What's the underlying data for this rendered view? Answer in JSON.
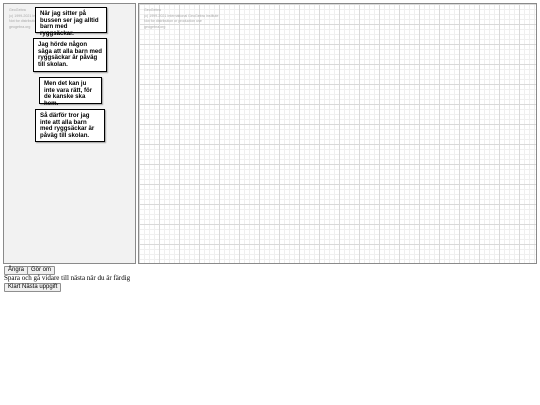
{
  "watermark": {
    "line1": "GeoGebra",
    "line2": "(c) 1999-2021 International GeoGebra Institute",
    "line3": "Not for distribution or production use",
    "line4": "geogebra.org"
  },
  "notes": [
    {
      "text": "När jag sitter på bussen ser jag alltid barn med ryggsäckar."
    },
    {
      "text": "Jag hörde någon säga att alla barn med ryggsäckar är påväg till skolan."
    },
    {
      "text": "Men det kan ju inte vara rätt, för de kanske ska hem."
    },
    {
      "text": "Så därför tror jag inte att alla barn med ryggsäckar är påväg till skolan."
    }
  ],
  "controls": {
    "undo_label": "Ångra",
    "redo_label": "Gör om",
    "instruction": "Spara och gå vidare till nästa när du är färdig",
    "next_label": "Klart Nästa uppgift"
  }
}
